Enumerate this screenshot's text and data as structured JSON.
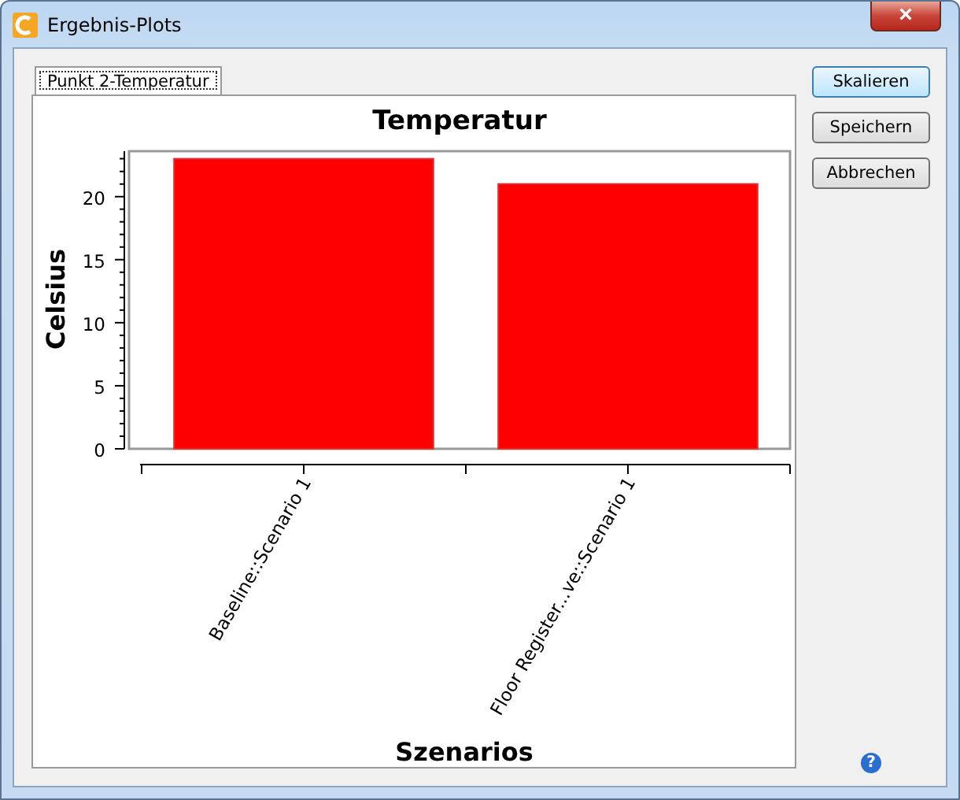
{
  "window": {
    "title": "Ergebnis-Plots",
    "close": "×"
  },
  "tabs": [
    {
      "label": "Punkt 2-Temperatur",
      "selected": true
    }
  ],
  "chart": {
    "chart_data": {
      "type": "bar",
      "title": "Temperatur",
      "xlabel": "Szenarios",
      "ylabel": "Celsius",
      "categories": [
        "Baseline::Scenario 1",
        "Floor Register...ve::Scenario 1"
      ],
      "values": [
        23,
        21
      ],
      "ylim": [
        0,
        23.6
      ],
      "yticks": [
        0,
        5,
        10,
        15,
        20
      ]
    }
  },
  "buttons": [
    {
      "label": "Skalieren",
      "selected": true
    },
    {
      "label": "Speichern",
      "selected": false
    },
    {
      "label": "Abbrechen",
      "selected": false
    }
  ],
  "help": "?"
}
